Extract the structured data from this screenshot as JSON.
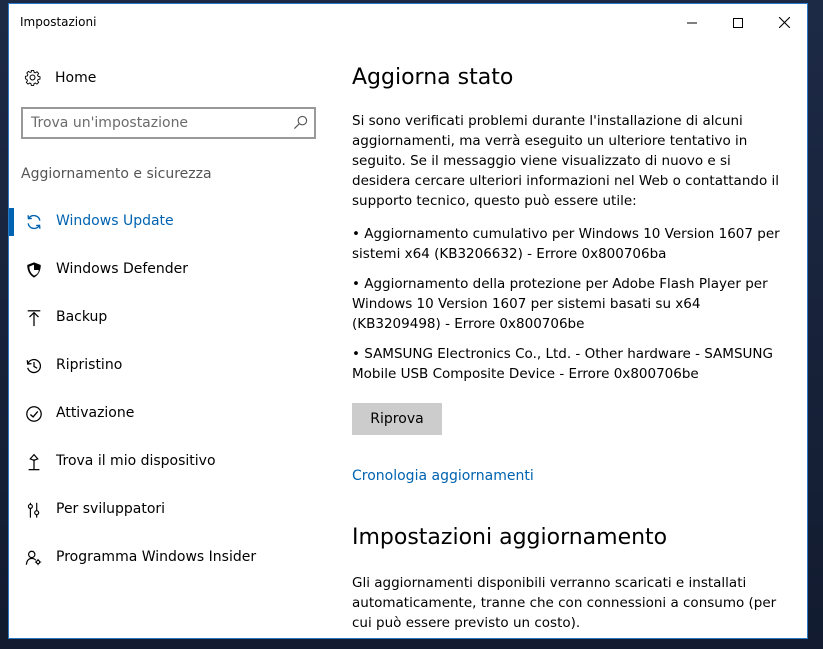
{
  "window": {
    "title": "Impostazioni"
  },
  "sidebar": {
    "home_label": "Home",
    "search_placeholder": "Trova un'impostazione",
    "section_label": "Aggiornamento e sicurezza",
    "items": [
      {
        "label": "Windows Update",
        "icon": "refresh-icon",
        "active": true
      },
      {
        "label": "Windows Defender",
        "icon": "shield-icon",
        "active": false
      },
      {
        "label": "Backup",
        "icon": "upload-arrow-icon",
        "active": false
      },
      {
        "label": "Ripristino",
        "icon": "history-icon",
        "active": false
      },
      {
        "label": "Attivazione",
        "icon": "check-circle-icon",
        "active": false
      },
      {
        "label": "Trova il mio dispositivo",
        "icon": "find-device-icon",
        "active": false
      },
      {
        "label": "Per sviluppatori",
        "icon": "developer-tools-icon",
        "active": false
      },
      {
        "label": "Programma Windows Insider",
        "icon": "insider-person-icon",
        "active": false
      }
    ]
  },
  "main": {
    "status_heading": "Aggiorna stato",
    "intro_text": "Si sono verificati problemi durante l'installazione di alcuni aggiornamenti, ma verrà eseguito un ulteriore tentativo in seguito. Se il messaggio viene visualizzato di nuovo e si desidera cercare ulteriori informazioni nel Web o contattando il supporto tecnico, questo può essere utile:",
    "errors": [
      "• Aggiornamento cumulativo per Windows 10 Version 1607 per sistemi x64 (KB3206632) - Errore 0x800706ba",
      "• Aggiornamento della protezione per Adobe Flash Player per Windows 10 Version 1607 per sistemi basati su x64 (KB3209498) - Errore 0x800706be",
      "• SAMSUNG Electronics Co., Ltd. - Other hardware - SAMSUNG Mobile USB Composite Device - Errore 0x800706be"
    ],
    "retry_label": "Riprova",
    "history_link": "Cronologia aggiornamenti",
    "settings_heading": "Impostazioni aggiornamento",
    "settings_text": "Gli aggiornamenti disponibili verranno scaricati e installati automaticamente, tranne che con connessioni a consumo (per cui può essere previsto un costo)."
  },
  "colors": {
    "accent": "#0063b1",
    "button_bg": "#cccccc",
    "window_border": "#2b78c2"
  }
}
